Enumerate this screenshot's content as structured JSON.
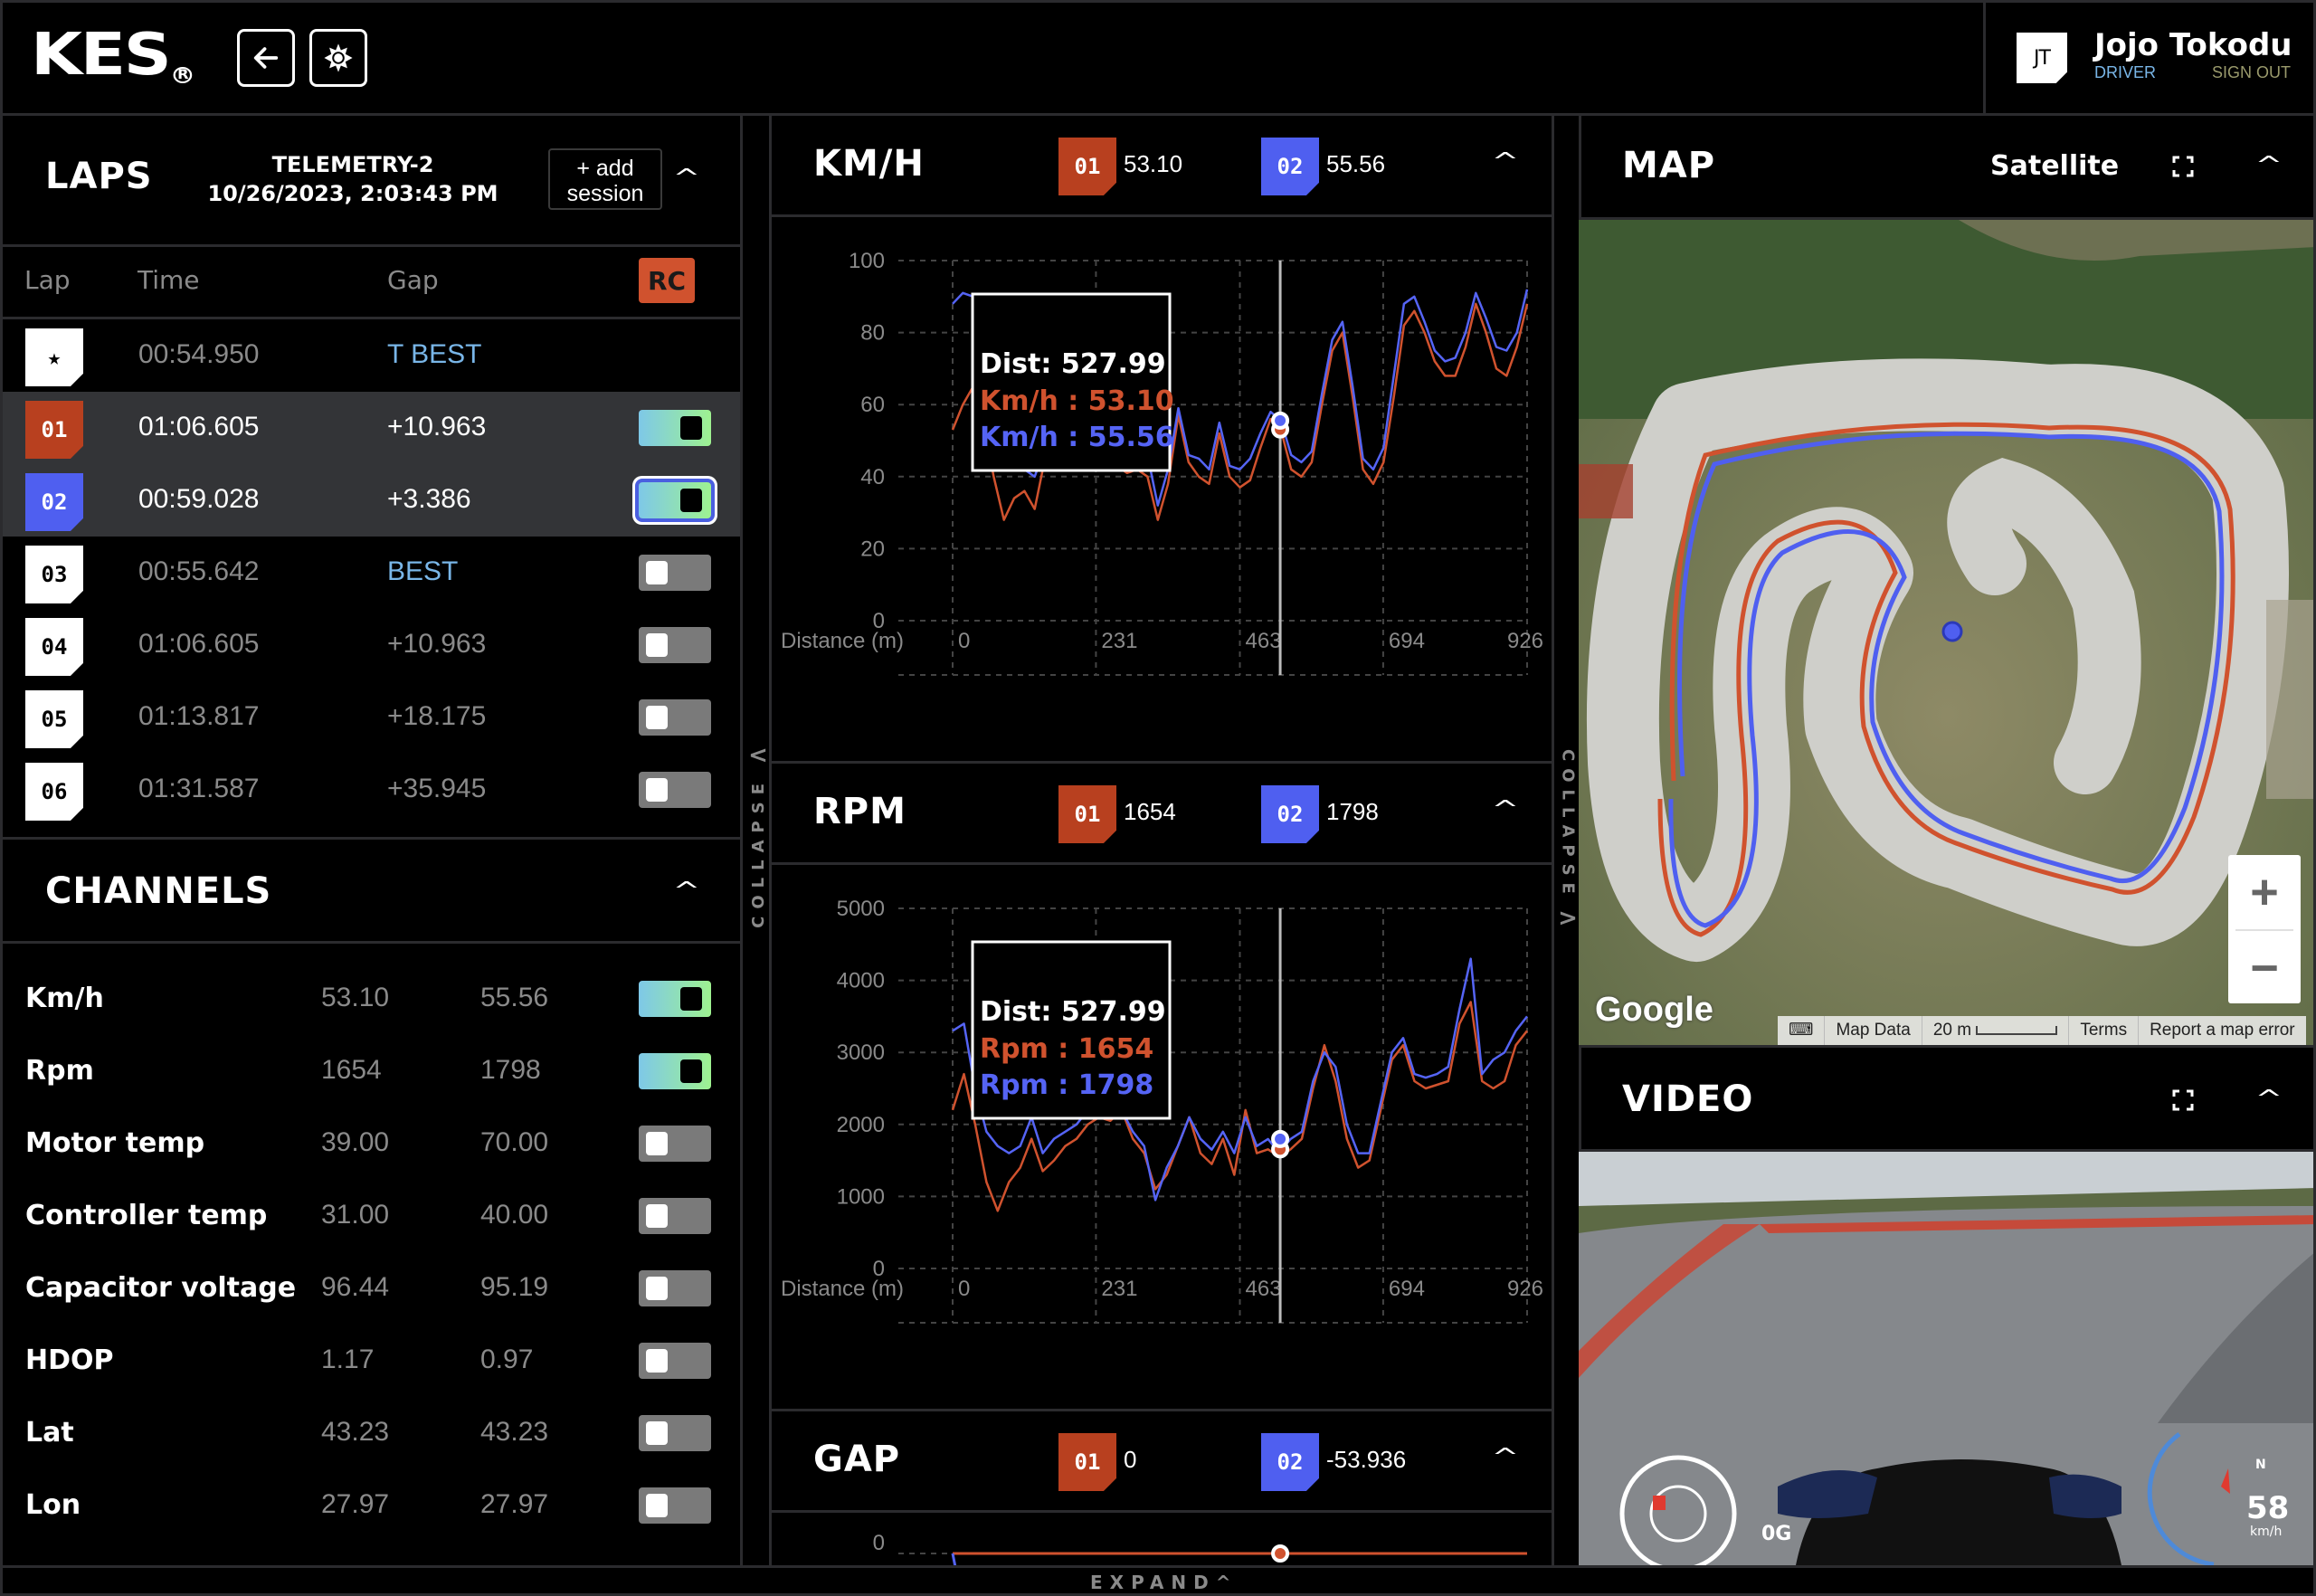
{
  "app": {
    "logo": "KES",
    "logo_mark": "R",
    "back_icon": "arrow-left-icon",
    "theme_icon": "sun-icon"
  },
  "user": {
    "initials": "JT",
    "name": "Jojo Tokodu",
    "role": "DRIVER",
    "sign_out": "SIGN OUT"
  },
  "laps": {
    "title": "LAPS",
    "session_name": "TELEMETRY-2",
    "session_datetime": "10/26/2023, 2:03:43 PM",
    "add_session": "+ add session",
    "columns": {
      "lap": "Lap",
      "time": "Time",
      "gap": "Gap",
      "rc": "RC"
    },
    "rows": [
      {
        "badge": "★",
        "time": "00:54.950",
        "gap": "T BEST",
        "gap_type": "label",
        "toggle": null,
        "selected": false,
        "color": "white"
      },
      {
        "badge": "01",
        "time": "01:06.605",
        "gap": "+10.963",
        "gap_type": "value",
        "toggle": true,
        "selected": true,
        "color": "orange"
      },
      {
        "badge": "02",
        "time": "00:59.028",
        "gap": "+3.386",
        "gap_type": "value",
        "toggle": true,
        "selected": true,
        "color": "blue",
        "focused": true
      },
      {
        "badge": "03",
        "time": "00:55.642",
        "gap": "BEST",
        "gap_type": "label",
        "toggle": false,
        "selected": false,
        "color": "white"
      },
      {
        "badge": "04",
        "time": "01:06.605",
        "gap": "+10.963",
        "gap_type": "value",
        "toggle": false,
        "selected": false,
        "color": "white"
      },
      {
        "badge": "05",
        "time": "01:13.817",
        "gap": "+18.175",
        "gap_type": "value",
        "toggle": false,
        "selected": false,
        "color": "white"
      },
      {
        "badge": "06",
        "time": "01:31.587",
        "gap": "+35.945",
        "gap_type": "value",
        "toggle": false,
        "selected": false,
        "color": "white"
      }
    ]
  },
  "channels": {
    "title": "CHANNELS",
    "rows": [
      {
        "name": "Km/h",
        "v1": "53.10",
        "v2": "55.56",
        "on": true
      },
      {
        "name": "Rpm",
        "v1": "1654",
        "v2": "1798",
        "on": true
      },
      {
        "name": "Motor temp",
        "v1": "39.00",
        "v2": "70.00",
        "on": false
      },
      {
        "name": "Controller temp",
        "v1": "31.00",
        "v2": "40.00",
        "on": false
      },
      {
        "name": "Capacitor voltage",
        "v1": "96.44",
        "v2": "95.19",
        "on": false
      },
      {
        "name": "HDOP",
        "v1": "1.17",
        "v2": "0.97",
        "on": false
      },
      {
        "name": "Lat",
        "v1": "43.23",
        "v2": "43.23",
        "on": false
      },
      {
        "name": "Lon",
        "v1": "27.97",
        "v2": "27.97",
        "on": false
      }
    ]
  },
  "collapse_label": "COLLAPSE",
  "expand_label": "EXPAND",
  "colors": {
    "lap1": "#b8401f",
    "lap2": "#4f5ff0",
    "lap1_line": "#d0522e",
    "lap2_line": "#5564f5",
    "accent_blue_text": "#79b6e8",
    "rc": "#d0522e",
    "toggle_on_start": "#7ec8e8",
    "toggle_on_end": "#9ef290"
  },
  "chart_data": [
    {
      "type": "line",
      "title": "KM/H",
      "legend": [
        {
          "lap": "01",
          "value": "53.10"
        },
        {
          "lap": "02",
          "value": "55.56"
        }
      ],
      "xlabel": "Distance (m)",
      "ylabel": "",
      "x_ticks": [
        0,
        231,
        463,
        694,
        926
      ],
      "y_ticks": [
        0,
        20,
        40,
        60,
        80,
        100
      ],
      "xlim": [
        0,
        926
      ],
      "ylim": [
        0,
        100
      ],
      "grid": true,
      "cursor_x": 527.99,
      "tooltip": {
        "dist": "Dist: 527.99",
        "s1": "Km/h : 53.10",
        "s2": "Km/h : 55.56"
      },
      "x": [
        0,
        10,
        20,
        35,
        50,
        60,
        70,
        85,
        100,
        115,
        130,
        150,
        170,
        190,
        210,
        230,
        250,
        270,
        290,
        310,
        330,
        350,
        370,
        385,
        400,
        420,
        440,
        455,
        470,
        490,
        505,
        515,
        528,
        540,
        560,
        580,
        600,
        620,
        640,
        660,
        680,
        700,
        720,
        740,
        760,
        780,
        800,
        820,
        840,
        860,
        880,
        900,
        926
      ],
      "series": [
        {
          "name": "Lap 01",
          "values": [
            53,
            60,
            65,
            55,
            40,
            28,
            34,
            36,
            31,
            45,
            47,
            42,
            44,
            43,
            42,
            44,
            43,
            41,
            42,
            40,
            28,
            38,
            57,
            44,
            40,
            38,
            52,
            40,
            37,
            39,
            48,
            56,
            53,
            42,
            40,
            44,
            60,
            75,
            80,
            62,
            42,
            38,
            44,
            62,
            82,
            86,
            80,
            72,
            68,
            68,
            76,
            88,
            80,
            70,
            68,
            76,
            88
          ]
        },
        {
          "name": "Lap 02",
          "values": [
            88,
            91,
            90,
            80,
            62,
            48,
            44,
            42,
            40,
            48,
            50,
            47,
            48,
            47,
            46,
            48,
            47,
            46,
            48,
            46,
            32,
            42,
            59,
            46,
            45,
            42,
            55,
            43,
            42,
            45,
            52,
            58,
            55.56,
            46,
            44,
            47,
            63,
            78,
            83,
            65,
            45,
            42,
            48,
            68,
            88,
            90,
            83,
            75,
            72,
            73,
            80,
            91,
            84,
            76,
            75,
            80,
            92
          ]
        }
      ]
    },
    {
      "type": "line",
      "title": "RPM",
      "legend": [
        {
          "lap": "01",
          "value": "1654"
        },
        {
          "lap": "02",
          "value": "1798"
        }
      ],
      "xlabel": "Distance (m)",
      "ylabel": "",
      "x_ticks": [
        0,
        231,
        463,
        694,
        926
      ],
      "y_ticks": [
        0,
        1000,
        2000,
        3000,
        4000,
        5000
      ],
      "xlim": [
        0,
        926
      ],
      "ylim": [
        0,
        5000
      ],
      "grid": true,
      "cursor_x": 527.99,
      "tooltip": {
        "dist": "Dist: 527.99",
        "s1": "Rpm : 1654",
        "s2": "Rpm : 1798"
      },
      "x": [
        0,
        8,
        20,
        35,
        45,
        55,
        70,
        90,
        110,
        130,
        150,
        170,
        190,
        210,
        230,
        250,
        270,
        290,
        310,
        330,
        345,
        360,
        380,
        400,
        420,
        440,
        460,
        480,
        500,
        515,
        528,
        545,
        565,
        585,
        600,
        620,
        640,
        660,
        680,
        700,
        720,
        740,
        760,
        780,
        800,
        815,
        825,
        840,
        860,
        880,
        900,
        926
      ],
      "series": [
        {
          "name": "Lap 01",
          "values": [
            2200,
            2700,
            2000,
            1200,
            800,
            1200,
            1400,
            1800,
            1350,
            1500,
            1700,
            1800,
            2000,
            2100,
            2050,
            2200,
            1800,
            1600,
            1100,
            1300,
            1700,
            2100,
            1600,
            1450,
            1800,
            1300,
            2200,
            1600,
            1654,
            1550,
            1654,
            1800,
            2500,
            3100,
            2600,
            1800,
            1400,
            1500,
            2200,
            2900,
            3100,
            2600,
            2500,
            2550,
            2600,
            3400,
            3700,
            2600,
            2500,
            2600,
            3100,
            3300
          ]
        },
        {
          "name": "Lap 02",
          "values": [
            3300,
            3400,
            2500,
            1900,
            1700,
            1600,
            1700,
            2100,
            1600,
            1800,
            1900,
            2000,
            2200,
            2200,
            2100,
            2200,
            1900,
            1700,
            950,
            1400,
            1700,
            2100,
            1800,
            1650,
            1900,
            1600,
            2100,
            1700,
            1798,
            1600,
            1798,
            1900,
            2600,
            3000,
            2800,
            2000,
            1600,
            1600,
            2300,
            3000,
            3200,
            2700,
            2650,
            2700,
            2800,
            3600,
            4300,
            2700,
            2900,
            3000,
            3300,
            3500
          ]
        }
      ]
    },
    {
      "type": "line",
      "title": "GAP",
      "legend": [
        {
          "lap": "01",
          "value": "0"
        },
        {
          "lap": "02",
          "value": "-53.936"
        }
      ],
      "xlabel": "",
      "ylabel": "",
      "y_ticks": [
        0
      ],
      "xlim": [
        0,
        926
      ],
      "grid": true,
      "cursor_x": 527.99,
      "x": [
        0,
        926
      ],
      "series": [
        {
          "name": "Lap 01",
          "values": [
            0,
            0
          ]
        }
      ]
    }
  ],
  "map": {
    "title": "MAP",
    "map_type": "Satellite",
    "fullscreen_icon": "fullscreen-icon",
    "zoom_in": "+",
    "zoom_out": "−",
    "google": "Google",
    "footer": {
      "keyboard_icon": "keyboard-icon",
      "map_data": "Map Data",
      "scale": "20 m",
      "terms": "Terms",
      "report": "Report a map error"
    }
  },
  "video": {
    "title": "VIDEO",
    "g_force": "0G",
    "speed": "58",
    "speed_unit": "km/h",
    "compass": "N"
  }
}
